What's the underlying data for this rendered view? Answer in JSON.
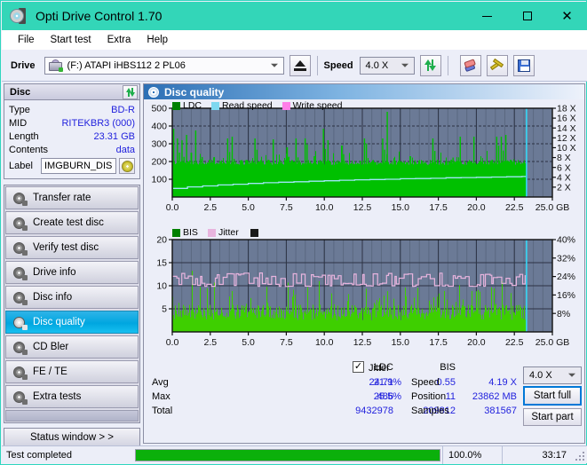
{
  "window": {
    "title": "Opti Drive Control 1.70",
    "icon": "disc-icon",
    "minimize": "minimize-icon",
    "maximize": "maximize-icon",
    "close": "close-icon"
  },
  "menu": [
    "File",
    "Start test",
    "Extra",
    "Help"
  ],
  "toolbar": {
    "drive_label": "Drive",
    "drive_value": "(F:)  ATAPI iHBS112  2 PL06",
    "eject_icon": "eject-icon",
    "speed_label": "Speed",
    "speed_value": "4.0 X",
    "refresh_icon": "refresh-icon",
    "eraser_icon": "eraser-icon",
    "tools_icon": "tools-icon",
    "save_icon": "save-icon"
  },
  "disc": {
    "header": "Disc",
    "refresh_icon": "refresh-icon",
    "rows": [
      {
        "key": "Type",
        "value": "BD-R"
      },
      {
        "key": "MID",
        "value": "RITEKBR3 (000)"
      },
      {
        "key": "Length",
        "value": "23.31 GB"
      },
      {
        "key": "Contents",
        "value": "data"
      }
    ],
    "label_key": "Label",
    "label_value": "IMGBURN_DIS",
    "label_button_icon": "cd-icon"
  },
  "nav": {
    "items": [
      {
        "label": "Transfer rate",
        "active": false
      },
      {
        "label": "Create test disc",
        "active": false
      },
      {
        "label": "Verify test disc",
        "active": false
      },
      {
        "label": "Drive info",
        "active": false
      },
      {
        "label": "Disc info",
        "active": false
      },
      {
        "label": "Disc quality",
        "active": true
      },
      {
        "label": "CD Bler",
        "active": false
      },
      {
        "label": "FE / TE",
        "active": false
      },
      {
        "label": "Extra tests",
        "active": false
      }
    ],
    "status_button": "Status window > >"
  },
  "panel": {
    "title": "Disc quality",
    "icon": "disc-quality-icon"
  },
  "stats": {
    "col_ldc": "LDC",
    "col_bis": "BIS",
    "rows": [
      {
        "key": "Avg",
        "ldc": "24.71",
        "bis": "0.55"
      },
      {
        "key": "Max",
        "ldc": "486",
        "bis": "11"
      },
      {
        "key": "Total",
        "ldc": "9432978",
        "bis": "209812"
      }
    ],
    "jitter_label": "Jitter",
    "jitter_checked": "✓",
    "jitter_avg": "21.9%",
    "jitter_max": "25.5%",
    "speed_key": "Speed",
    "speed_value": "4.19 X",
    "position_key": "Position",
    "position_value": "23862 MB",
    "samples_key": "Samples",
    "samples_value": "381567",
    "speed_select": "4.0 X",
    "start_full": "Start full",
    "start_part": "Start part"
  },
  "statusbar": {
    "message": "Test completed",
    "percent": "100.0%",
    "progress_value": 100,
    "time": "33:17"
  },
  "colors": {
    "title_bar": "#33d6b8",
    "plot_bg": "#6b7a96",
    "ldc_green": "#00c000",
    "bis_green": "#3ecf00",
    "read_speed": "#7fd8f0",
    "write_speed": "#ff7fe8",
    "jitter_pink": "#e8b4de",
    "value_blue": "#2222dd",
    "accent_blue": "#0078d7",
    "progress_green": "#0bb00b"
  },
  "chart_data": [
    {
      "type": "area",
      "name": "quality-chart-ldc",
      "title": "",
      "legend": [
        {
          "label": "LDC",
          "color": "#008000"
        },
        {
          "label": "Read speed",
          "color": "#7fd8f0"
        },
        {
          "label": "Write speed",
          "color": "#ff7fe8"
        }
      ],
      "legend_position": "top-left",
      "xlabel": "GB",
      "ylabel": "",
      "xlim": [
        0,
        25.0
      ],
      "ylim": [
        0,
        500
      ],
      "xticks": [
        0.0,
        2.5,
        5.0,
        7.5,
        10.0,
        12.5,
        15.0,
        17.5,
        20.0,
        22.5,
        25.0
      ],
      "xticklabels": [
        "0.0",
        "2.5",
        "5.0",
        "7.5",
        "10.0",
        "12.5",
        "15.0",
        "17.5",
        "20.0",
        "22.5",
        "25.0 GB"
      ],
      "yticks": [
        100,
        200,
        300,
        400,
        500
      ],
      "yticklabels": [
        "100",
        "200",
        "300",
        "400",
        "500"
      ],
      "y2label": "X",
      "y2lim": [
        0,
        18
      ],
      "y2ticks": [
        2,
        4,
        6,
        8,
        10,
        12,
        14,
        16,
        18
      ],
      "y2ticklabels": [
        "2 X",
        "4 X",
        "6 X",
        "8 X",
        "10 X",
        "12 X",
        "14 X",
        "16 X",
        "18 X"
      ],
      "grid": true,
      "data_end_x": 23.3,
      "series": [
        {
          "name": "LDC",
          "color": "#00c000",
          "axis": "left",
          "baseline_mean": 195,
          "x": [
            0.05,
            0.3,
            0.6,
            0.9,
            1.2,
            1.5,
            1.8,
            2.1,
            2.4,
            2.7,
            3.0,
            3.3,
            3.6,
            3.9,
            4.2,
            4.5,
            4.8,
            5.1,
            5.4,
            5.7,
            6.0,
            6.3,
            6.6,
            6.9,
            7.2,
            7.5,
            7.8,
            8.1,
            8.4,
            8.7,
            9.0,
            9.3,
            9.6,
            9.9,
            10.2,
            10.5,
            10.8,
            11.1,
            11.4,
            11.7,
            12.0,
            12.3,
            12.6,
            12.9,
            13.2,
            13.5,
            13.8,
            14.1,
            14.4,
            14.7,
            15.0,
            15.3,
            15.6,
            15.9,
            16.2,
            16.5,
            16.8,
            17.1,
            17.4,
            17.7,
            18.0,
            18.3,
            18.6,
            18.9,
            19.2,
            19.5,
            19.8,
            20.1,
            20.4,
            20.7,
            21.0,
            21.3,
            21.6,
            21.9,
            22.2,
            22.5,
            22.8,
            23.1,
            23.3
          ],
          "peaks": [
            385,
            330,
            320,
            350,
            250,
            375,
            215,
            205,
            210,
            225,
            200,
            195,
            330,
            340,
            200,
            200,
            195,
            190,
            330,
            185,
            175,
            185,
            325,
            200,
            195,
            280,
            195,
            330,
            195,
            330,
            195,
            230,
            195,
            385,
            320,
            195,
            200,
            290,
            200,
            195,
            200,
            195,
            330,
            195,
            205,
            195,
            330,
            480,
            200,
            195,
            195,
            200,
            230,
            205,
            200,
            195,
            200,
            330,
            210,
            200,
            200,
            210,
            200,
            340,
            205,
            200,
            340,
            200,
            205,
            205,
            210,
            340,
            340,
            350,
            210,
            200,
            200,
            195,
            195
          ]
        },
        {
          "name": "Read speed",
          "color": "#7fd8f0",
          "axis": "right",
          "x": [
            0.05,
            1,
            2,
            3,
            4,
            5,
            6,
            7,
            8,
            9,
            10,
            11,
            12,
            13,
            14,
            15,
            16,
            17,
            18,
            19,
            20,
            21,
            22,
            23,
            23.3
          ],
          "values": [
            1.75,
            2.05,
            2.25,
            2.45,
            2.6,
            2.75,
            2.9,
            3.0,
            3.1,
            3.2,
            3.3,
            3.4,
            3.5,
            3.55,
            3.6,
            3.7,
            3.75,
            3.8,
            3.9,
            3.95,
            4.0,
            4.05,
            4.1,
            4.15,
            4.19
          ]
        },
        {
          "name": "Write speed",
          "color": "#ff7fe8",
          "axis": "right",
          "x": [],
          "values": []
        }
      ]
    },
    {
      "type": "area",
      "name": "quality-chart-bis",
      "title": "",
      "legend": [
        {
          "label": "BIS",
          "color": "#008000"
        },
        {
          "label": "Jitter",
          "color": "#e8b4de"
        }
      ],
      "legend_position": "top-left",
      "xlabel": "GB",
      "ylabel": "",
      "xlim": [
        0,
        25.0
      ],
      "ylim": [
        0,
        20
      ],
      "xticks": [
        0.0,
        2.5,
        5.0,
        7.5,
        10.0,
        12.5,
        15.0,
        17.5,
        20.0,
        22.5,
        25.0
      ],
      "xticklabels": [
        "0.0",
        "2.5",
        "5.0",
        "7.5",
        "10.0",
        "12.5",
        "15.0",
        "17.5",
        "20.0",
        "22.5",
        "25.0 GB"
      ],
      "yticks": [
        5,
        10,
        15,
        20
      ],
      "yticklabels": [
        "5",
        "10",
        "15",
        "20"
      ],
      "y2label": "%",
      "y2lim": [
        0,
        40
      ],
      "y2ticks": [
        8,
        16,
        24,
        32,
        40
      ],
      "y2ticklabels": [
        "8%",
        "16%",
        "24%",
        "32%",
        "40%"
      ],
      "grid": true,
      "data_end_x": 23.3,
      "series": [
        {
          "name": "BIS",
          "color": "#3ecf00",
          "axis": "left",
          "baseline_mean": 4.2,
          "peak_max": 10
        },
        {
          "name": "Jitter",
          "color": "#e8b4de",
          "axis": "right",
          "band_low": 20.0,
          "band_high": 25.0,
          "mean": 21.9
        }
      ]
    }
  ]
}
